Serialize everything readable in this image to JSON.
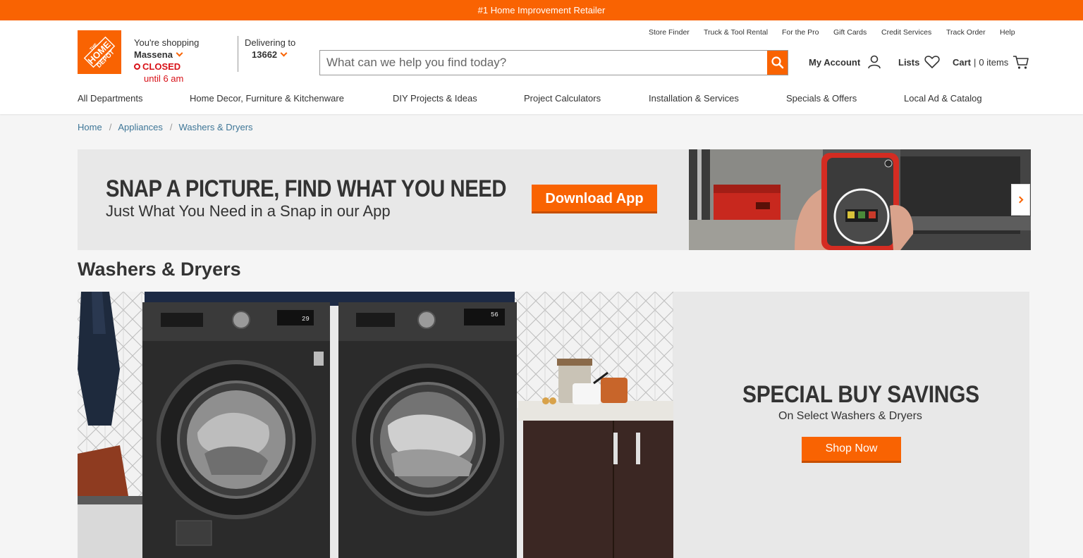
{
  "top_banner": "#1 Home Improvement Retailer",
  "logo_text": "THE HOME DEPOT",
  "store": {
    "label": "You're shopping",
    "name": "Massena",
    "status": "CLOSED",
    "until": "until 6 am"
  },
  "delivery": {
    "label": "Delivering to",
    "zip": "13662"
  },
  "search": {
    "placeholder": "What can we help you find today?"
  },
  "utility_links": [
    "Store Finder",
    "Truck & Tool Rental",
    "For the Pro",
    "Gift Cards",
    "Credit Services",
    "Track Order",
    "Help"
  ],
  "account": {
    "my_account": "My Account",
    "lists": "Lists",
    "cart": "Cart",
    "cart_sep": "|",
    "cart_items": "0 items"
  },
  "nav": [
    "All Departments",
    "Home Decor, Furniture & Kitchenware",
    "DIY Projects & Ideas",
    "Project Calculators",
    "Installation & Services",
    "Specials & Offers",
    "Local Ad & Catalog"
  ],
  "breadcrumb": [
    "Home",
    "Appliances",
    "Washers & Dryers"
  ],
  "promo": {
    "headline": "SNAP A PICTURE, FIND WHAT YOU NEED",
    "subhead": "Just What You Need in a Snap in our App",
    "button": "Download App"
  },
  "page_title": "Washers & Dryers",
  "hero": {
    "headline": "SPECIAL BUY SAVINGS",
    "subhead": "On Select Washers & Dryers",
    "button": "Shop Now"
  },
  "colors": {
    "brand_orange": "#f96302",
    "closed_red": "#d81118",
    "link_blue": "#3e7697"
  }
}
